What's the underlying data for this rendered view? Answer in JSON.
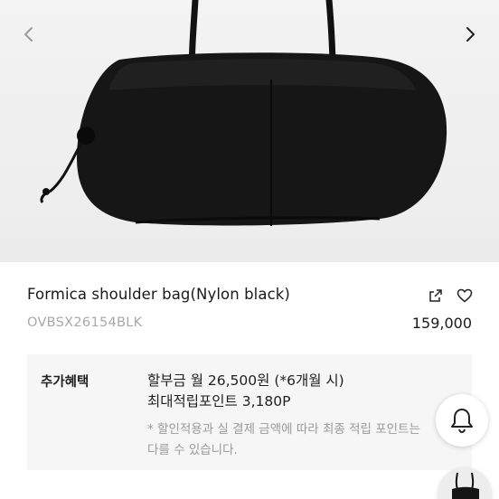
{
  "gallery": {
    "image_alt": "Formica shoulder bag nylon black product photo",
    "prev_icon": "chevron-left-icon",
    "next_icon": "chevron-right-icon"
  },
  "product": {
    "title": "Formica shoulder bag(Nylon black)",
    "code": "OVBSX26154BLK",
    "price": "159,000",
    "share_icon": "share-icon",
    "wishlist_icon": "heart-icon"
  },
  "benefits": {
    "label": "추가혜택",
    "installment": "할부금 월 26,500원 (*6개월 시)",
    "points": "최대적립포인트 3,180P",
    "note": "* 할인적용과 실 결제 금액에 따라 최종 적립 포인트는 다를 수 있습니다."
  },
  "floating": {
    "bell_icon": "bell-icon",
    "thumbnail_alt": "recently viewed product thumbnail"
  }
}
